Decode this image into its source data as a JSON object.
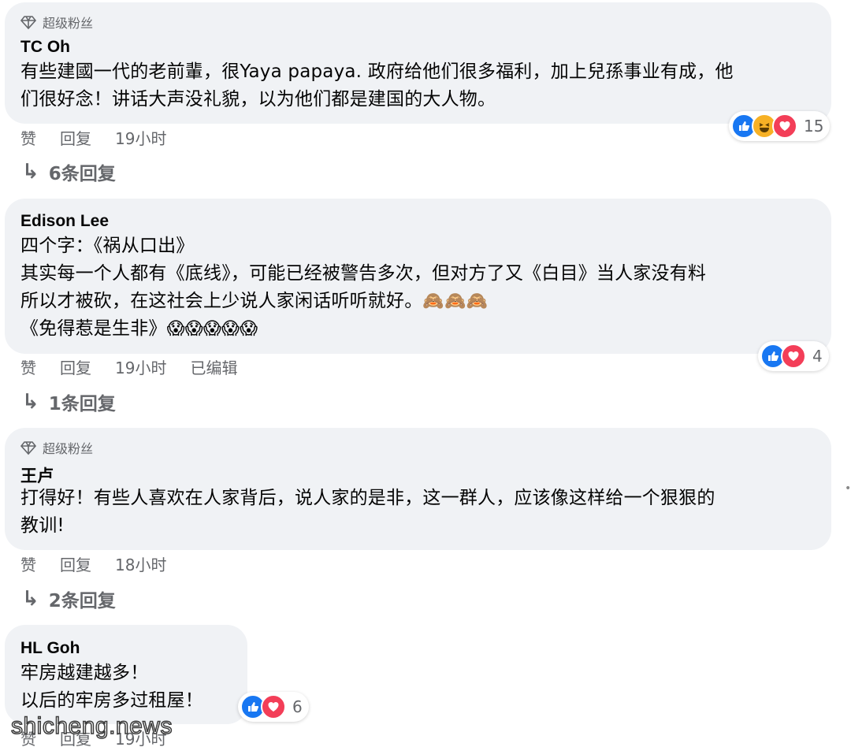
{
  "comments": [
    {
      "badge": "超级粉丝",
      "name": "TC Oh",
      "lines": [
        "有些建國一代的老前輩，很Yaya papaya. 政府给他们很多福利，加上兒孫事业有成，他",
        "们很好念！讲话大声没礼貌，以为他们都是建国的大人物。"
      ],
      "like": "赞",
      "reply": "回复",
      "time": "19小时",
      "reaction_count": "15",
      "reactions": [
        "like",
        "haha",
        "love"
      ],
      "replies": "6条回复"
    },
    {
      "name": "Edison Lee",
      "lines": [
        "四个字：《祸从口出》",
        "其实每一个人都有《底线》，可能已经被警告多次，但对方了又《白目》当人家没有料",
        "所以才被砍，在这社会上少说人家闲话听听就好。",
        "《免得惹是生非》"
      ],
      "emoji_line3": "🙈🙈🙈",
      "emoji_line4": "😱😱😱😱😱",
      "like": "赞",
      "reply": "回复",
      "time": "19小时",
      "edited": "已编辑",
      "reaction_count": "4",
      "reactions": [
        "like",
        "love"
      ],
      "replies": "1条回复"
    },
    {
      "badge": "超级粉丝",
      "name": "王卢",
      "lines": [
        "打得好！有些人喜欢在人家背后，说人家的是非，这一群人，应该像这样给一个狠狠的",
        "教训!"
      ],
      "like": "赞",
      "reply": "回复",
      "time": "18小时",
      "replies": "2条回复"
    },
    {
      "name": "HL Goh",
      "lines": [
        "牢房越建越多！",
        "以后的牢房多过租屋！"
      ],
      "like": "赞",
      "reply": "回复",
      "time": "19小时",
      "reaction_count": "6",
      "reactions": [
        "like",
        "love"
      ]
    }
  ],
  "watermark": "shicheng.news",
  "colors": {
    "bubble": "#f0f2f5",
    "meta": "#65676b",
    "like": "#1877f2",
    "love": "#f33e58",
    "haha": "#f7b125"
  }
}
